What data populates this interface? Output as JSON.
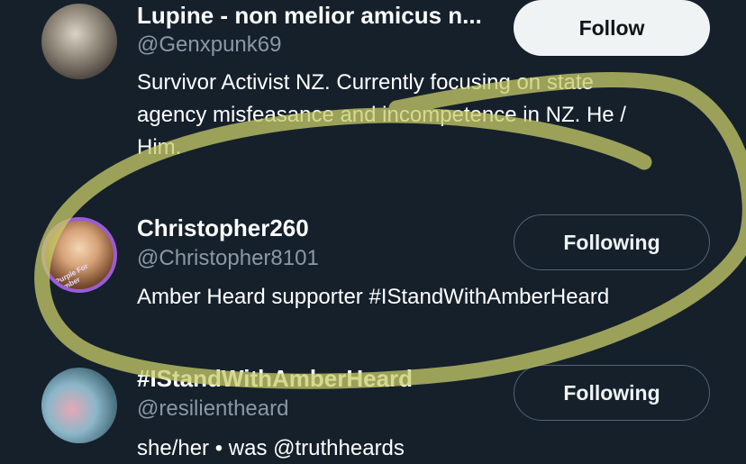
{
  "users": [
    {
      "name": "Lupine - non melior amicus n...",
      "handle": "@Genxpunk69",
      "bio_lines": [
        "Survivor Activist NZ. Currently focusing on state",
        "agency misfeasance and incompetence in NZ. He /",
        "Him."
      ],
      "button": "Follow"
    },
    {
      "name": "Christopher260",
      "handle": "@Christopher8101",
      "avatar_tag": "Purple For Amber",
      "bio_lines": [
        "Amber Heard supporter #IStandWithAmberHeard"
      ],
      "button": "Following"
    },
    {
      "name": "#IStandWithAmberHeard",
      "handle": "@resilientheard",
      "bio_lines": [
        "she/her • was @truthheards"
      ],
      "button": "Following"
    }
  ],
  "colors": {
    "background": "#15202b",
    "secondary_text": "#8b98a5",
    "highlight_scribble": "#c8cc6a",
    "avatar_ring": "#9b5cd6"
  }
}
